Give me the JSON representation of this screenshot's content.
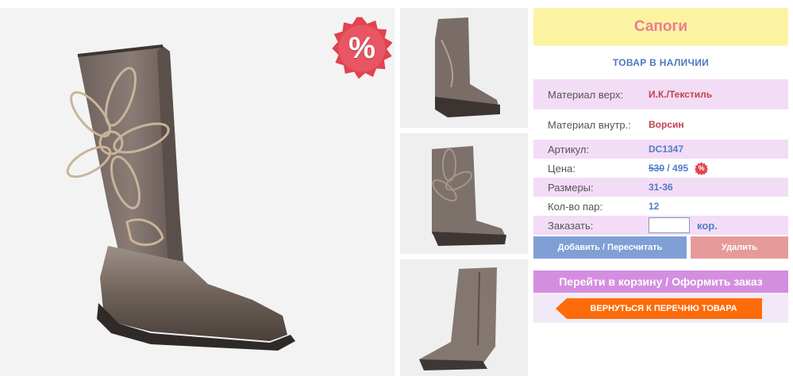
{
  "product": {
    "title": "Сапоги",
    "stock_status": "ТОВАР В НАЛИЧИИ",
    "sale_badge": "%",
    "images": [
      "boot-side-flower-main",
      "boot-side-thumb",
      "boot-angle-thumb",
      "boot-inner-zip-thumb"
    ]
  },
  "specs": {
    "material_upper_label": "Материал верх:",
    "material_upper_value": "И.К./Текстиль",
    "material_inner_label": "Материал внутр.:",
    "material_inner_value": "Ворсин",
    "article_label": "Артикул:",
    "article_value": "DC1347",
    "price_label": "Цена:",
    "price_old": "530",
    "price_separator": " / ",
    "price_new": "495",
    "price_sale_icon": "%",
    "sizes_label": "Размеры:",
    "sizes_value": "31-36",
    "pairs_label": "Кол-во пар:",
    "pairs_value": "12",
    "order_label": "Заказать:",
    "order_value": "",
    "order_unit": "кор."
  },
  "actions": {
    "add_label": "Добавить / Пересчитать",
    "delete_label": "Удалить",
    "cart_label": "Перейти в корзину / Оформить заказ",
    "back_label": "ВЕРНУТЬСЯ К ПЕРЕЧНЮ ТОВАРА"
  },
  "colors": {
    "title_bg": "#fcf3a2",
    "title_text": "#ea7c92",
    "row_pink": "#f3dcf6",
    "value_blue": "#4f7ec7",
    "value_red": "#c0434f",
    "add_button": "#7f9fd5",
    "delete_button": "#e79a9a",
    "cart_button": "#d48ee0",
    "back_button": "#fd6b0a",
    "sale_badge": "#e0444f"
  }
}
